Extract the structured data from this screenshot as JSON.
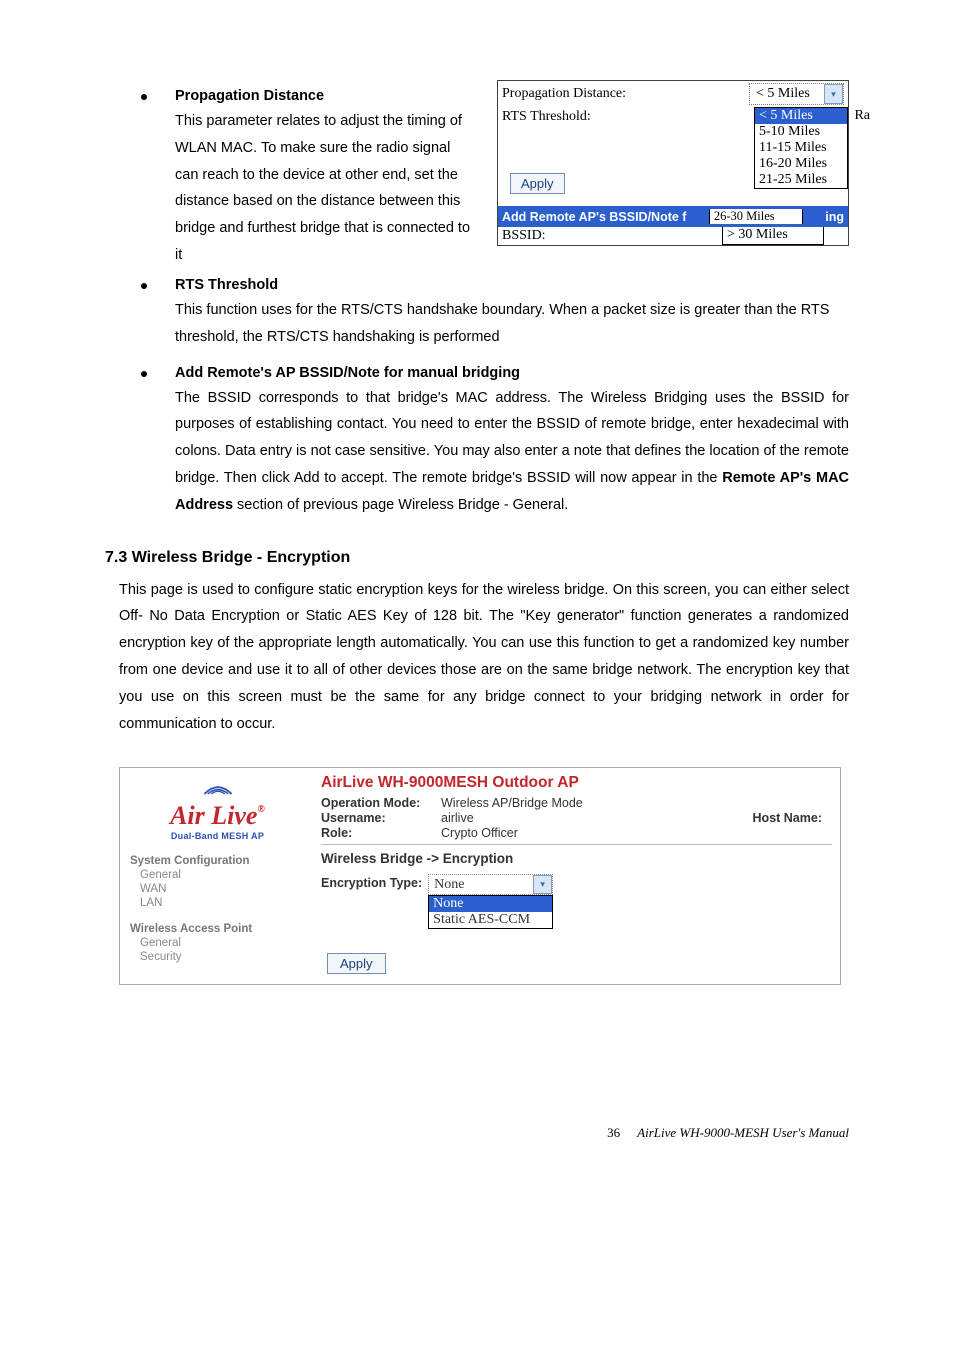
{
  "sections": {
    "propagation": {
      "heading": "Propagation Distance",
      "body": "This parameter relates to adjust the timing of WLAN MAC. To make sure the radio signal can reach to the device at other end, set the distance based on the distance between this bridge and furthest bridge that is connected to it"
    },
    "rts": {
      "heading": "RTS Threshold",
      "body": "This function uses for the RTS/CTS handshake boundary. When a packet size is greater than the RTS threshold, the RTS/CTS handshaking is performed"
    },
    "addremote": {
      "heading": "Add Remote's AP BSSID/Note for manual bridging",
      "body_pre": "The BSSID corresponds to that bridge's MAC address. The Wireless Bridging uses the BSSID for purposes of establishing contact. You need to enter the BSSID of remote bridge, enter hexadecimal with colons. Data entry is not case sensitive. You may also enter a note that defines the location of the remote bridge. Then click Add to accept. The remote bridge's BSSID will now appear in the ",
      "body_bold": "Remote AP's MAC Address",
      "body_post": " section of previous page Wireless Bridge - General."
    },
    "h73": {
      "heading": "7.3 Wireless Bridge - Encryption",
      "body": "This page is used to configure static encryption keys for the wireless bridge. On this screen, you can either select Off- No Data Encryption or Static AES Key of 128 bit. The \"Key generator\" function generates a randomized encryption key of the appropriate length automatically. You can use this function to get a randomized key number from one device and use it to all of other devices those are on the same bridge network. The encryption key that you use on this screen must be the same for any bridge connect to your bridging network in order for communication to occur."
    }
  },
  "shot1": {
    "propagation_label": "Propagation Distance:",
    "propagation_value": "< 5 Miles",
    "rts_label": "RTS Threshold:",
    "extra_right": "Ra",
    "apply": "Apply",
    "options": [
      "< 5 Miles",
      "5-10 Miles",
      "11-15 Miles",
      "16-20 Miles",
      "21-25 Miles",
      "26-30 Miles",
      "> 30 Miles"
    ],
    "bluebar_left": "Add Remote AP's BSSID/Note f",
    "bluebar_right": "ing",
    "bssid_label": "BSSID:"
  },
  "shot2": {
    "logo_text": "Air Live",
    "logo_sub": "Dual-Band MESH AP",
    "nav": {
      "g1": "System Configuration",
      "g1_items": [
        "General",
        "WAN",
        "LAN"
      ],
      "g2": "Wireless Access Point",
      "g2_items": [
        "General",
        "Security"
      ]
    },
    "title": "AirLive WH-9000MESH Outdoor AP",
    "kv": {
      "opmode_k": "Operation Mode:",
      "opmode_v": "Wireless AP/Bridge Mode",
      "user_k": "Username:",
      "user_v": "airlive",
      "role_k": "Role:",
      "role_v": "Crypto Officer",
      "host_k": "Host Name:"
    },
    "crumb": "Wireless Bridge -> Encryption",
    "enc_label": "Encryption Type:",
    "enc_value": "None",
    "enc_options": [
      "None",
      "Static AES-CCM"
    ],
    "apply": "Apply"
  },
  "footer": {
    "page": "36",
    "title": "AirLive WH-9000-MESH User's Manual"
  }
}
